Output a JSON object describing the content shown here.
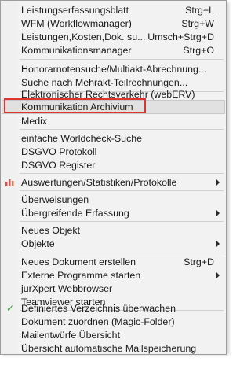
{
  "menu": {
    "items": [
      {
        "label": "Leistungserfassungsblatt",
        "shortcut": "Strg+L"
      },
      {
        "label": "WFM (Workflowmanager)",
        "shortcut": "Strg+W"
      },
      {
        "label": "Leistungen,Kosten,Dok. su...",
        "shortcut": "Umsch+Strg+D"
      },
      {
        "label": "Kommunikationsmanager",
        "shortcut": "Strg+O"
      },
      {
        "label": "Honorarnotensuche/Multiakt-Abrechnung..."
      },
      {
        "label": "Suche nach Mehrakt-Teilrechnungen..."
      },
      {
        "label": "Elektronischer Rechtsverkehr (webERV)"
      },
      {
        "label": "Kommunikation Archivium"
      },
      {
        "label": "Medix"
      },
      {
        "label": "einfache Worldcheck-Suche"
      },
      {
        "label": "DSGVO Protokoll"
      },
      {
        "label": "DSGVO Register"
      },
      {
        "label": "Auswertungen/Statistiken/Protokolle",
        "icon": "bar-chart-icon"
      },
      {
        "label": "Überweisungen"
      },
      {
        "label": "Übergreifende Erfassung"
      },
      {
        "label": "Neues Objekt"
      },
      {
        "label": "Objekte"
      },
      {
        "label": "Neues Dokument erstellen",
        "shortcut": "Strg+D"
      },
      {
        "label": "Externe Programme starten"
      },
      {
        "label": "jurXpert Webbrowser"
      },
      {
        "label": "Teamviewer starten"
      },
      {
        "label": "Definiertes Verzeichnis überwachen",
        "icon": "checkmark-icon"
      },
      {
        "label": "Dokument zuordnen (Magic-Folder)"
      },
      {
        "label": "Mailentwürfe Übersicht"
      },
      {
        "label": "Übersicht automatische Mailspeicherung"
      }
    ]
  },
  "colors": {
    "highlight_box": "#e0322e",
    "check": "#3aa13a",
    "chart_icon": "#d9534f"
  }
}
